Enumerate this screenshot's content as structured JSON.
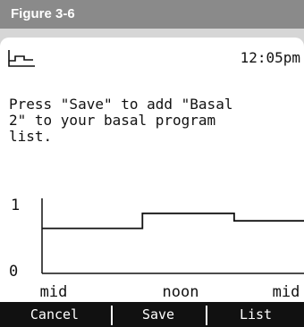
{
  "figure": {
    "label": "Figure 3-6"
  },
  "status": {
    "time": "12:05pm",
    "icon": "basal-program-icon"
  },
  "message": {
    "text": "Press \"Save\" to add \"Basal\n2\" to your basal program\nlist."
  },
  "chart_data": {
    "type": "line",
    "step": true,
    "x_ticks": [
      "mid",
      "noon",
      "mid"
    ],
    "xlim": [
      0,
      24
    ],
    "ylim": [
      0,
      1
    ],
    "y_ticks": [
      "0",
      "1"
    ],
    "series": [
      {
        "x": [
          0,
          9.2,
          9.2,
          17.6,
          17.6,
          24
        ],
        "y": [
          0.6,
          0.6,
          0.8,
          0.8,
          0.7,
          0.7
        ]
      }
    ]
  },
  "softkeys": {
    "left": "Cancel",
    "middle": "Save",
    "right": "List"
  },
  "colors": {
    "header": "#8a8a8a",
    "screen_bezel": "#d6d6d6",
    "softkey_bar": "#111111"
  }
}
